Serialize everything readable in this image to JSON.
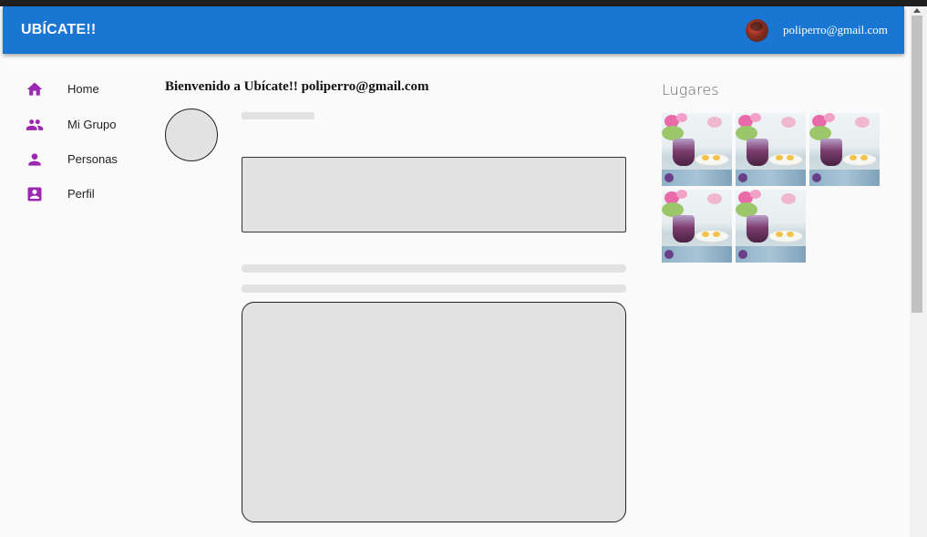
{
  "header": {
    "title": "UBÍCATE!!",
    "user_email": "poliperro@gmail.com",
    "brand_color": "#1976d2"
  },
  "nav": {
    "icon_color": "#9c27b0",
    "items": [
      {
        "label": "Home",
        "icon": "home-icon"
      },
      {
        "label": "Mi Grupo",
        "icon": "group-icon"
      },
      {
        "label": "Personas",
        "icon": "person-icon"
      },
      {
        "label": "Perfil",
        "icon": "account-box-icon"
      }
    ]
  },
  "main": {
    "welcome": "Bienvenido a Ubícate!! poliperro@gmail.com"
  },
  "places": {
    "title": "Lugares",
    "thumbnail_count": 5
  }
}
